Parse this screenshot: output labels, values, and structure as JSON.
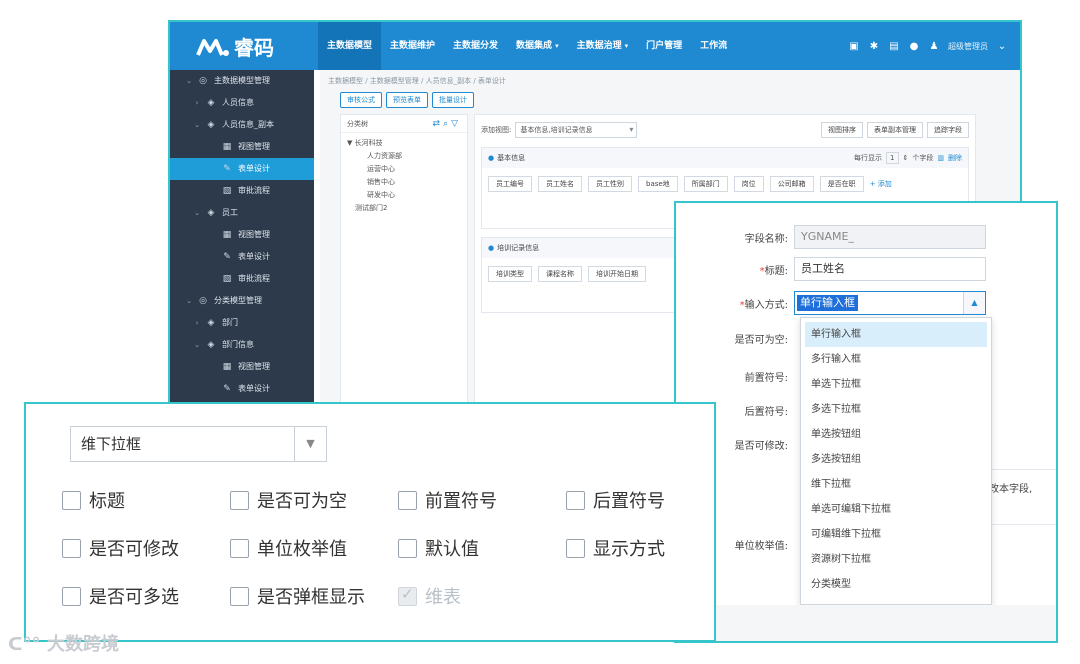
{
  "app": {
    "logo_text": "睿码",
    "nav": [
      {
        "label": "主数据模型",
        "active": true
      },
      {
        "label": "主数据维护"
      },
      {
        "label": "主数据分发"
      },
      {
        "label": "数据集成",
        "caret": "▾"
      },
      {
        "label": "主数据治理",
        "caret": "▾"
      },
      {
        "label": "门户管理"
      },
      {
        "label": "工作流"
      }
    ],
    "user_name": "超级管理员"
  },
  "sidebar": {
    "items": [
      {
        "label": "主数据模型管理"
      },
      {
        "label": "人员信息"
      },
      {
        "label": "人员信息_副本"
      },
      {
        "label": "视图管理"
      },
      {
        "label": "表单设计"
      },
      {
        "label": "审批流程"
      },
      {
        "label": "员工"
      },
      {
        "label": "视图管理"
      },
      {
        "label": "表单设计"
      },
      {
        "label": "审批流程"
      },
      {
        "label": "分类模型管理"
      },
      {
        "label": "部门"
      },
      {
        "label": "部门信息"
      },
      {
        "label": "视图管理"
      },
      {
        "label": "表单设计"
      }
    ]
  },
  "breadcrumb": "主数据模型 / 主数据模型管理 / 人员信息_副本 / 表单设计",
  "buttons": {
    "b1": "审核公式",
    "b2": "预览表单",
    "b3": "批量设计"
  },
  "tree": {
    "title": "分类树",
    "nodes": [
      "▼ 长河科技",
      "人力资源部",
      "运营中心",
      "销售中心",
      "研发中心",
      "测试部门2"
    ]
  },
  "main": {
    "add_view_label": "添加视图:",
    "view_select": "基本信息,培训记录信息",
    "right_buttons": [
      "视图排序",
      "表单副本管理",
      "追踪字段"
    ],
    "section1": {
      "title": "基本信息",
      "per_row_label": "每行显示",
      "per_row_value": "1",
      "per_row_unit": "个字段",
      "delete_label": "删除",
      "chips": [
        "员工编号",
        "员工姓名",
        "员工性别",
        "base地",
        "所属部门",
        "岗位",
        "公司邮箱",
        "是否在职"
      ],
      "add_label": "+ 添加"
    },
    "section2": {
      "title": "培训记录信息",
      "chips": [
        "培训类型",
        "课程名称",
        "培训开始日期"
      ]
    }
  },
  "detail": {
    "field_name_label": "字段名称:",
    "field_name_value": "YGNAME_",
    "title_label": "标题:",
    "title_value": "员工姓名",
    "input_mode_label": "输入方式:",
    "input_mode_value": "单行输入框",
    "nullable_label": "是否可为空:",
    "prefix_label": "前置符号:",
    "suffix_label": "后置符号:",
    "editable_label": "是否可修改:",
    "unit_enum_label": "单位枚举值:",
    "side_note": "改本字段,",
    "options": [
      "单行输入框",
      "多行输入框",
      "单选下拉框",
      "多选下拉框",
      "单选按钮组",
      "多选按钮组",
      "维下拉框",
      "单选可编辑下拉框",
      "可编辑维下拉框",
      "资源树下拉框",
      "分类模型"
    ]
  },
  "zoom": {
    "select_value": "维下拉框",
    "checkboxes": [
      {
        "label": "标题"
      },
      {
        "label": "是否可为空"
      },
      {
        "label": "前置符号"
      },
      {
        "label": "后置符号"
      },
      {
        "label": "是否可修改"
      },
      {
        "label": "单位枚举值"
      },
      {
        "label": "默认值"
      },
      {
        "label": "显示方式"
      },
      {
        "label": "是否可多选"
      },
      {
        "label": "是否弹框显示"
      },
      {
        "label": "维表",
        "checked": true,
        "disabled": true
      }
    ]
  },
  "watermark": "大数跨境",
  "colors": {
    "accent": "#1f8ad2",
    "frame": "#35c6cc",
    "sidebar": "#2d3a4b",
    "active": "#1f9dd9"
  }
}
